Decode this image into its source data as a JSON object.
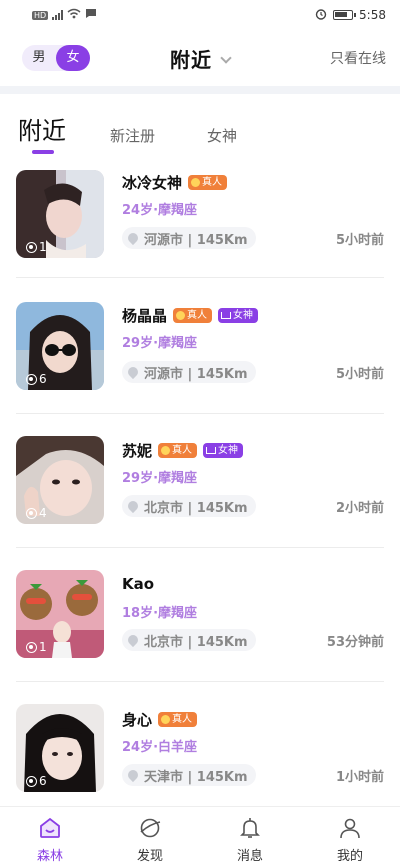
{
  "status_bar": {
    "indicators": "HD ⁴ᴳ",
    "time": "5:58",
    "icons": [
      "hd-icon",
      "signal-icon",
      "wifi-icon",
      "message-icon",
      "alarm-icon",
      "battery-icon"
    ]
  },
  "header": {
    "gender_male": "男",
    "gender_female": "女",
    "title": "附近",
    "online_only": "只看在线"
  },
  "tabs": [
    {
      "label": "附近",
      "active": true
    },
    {
      "label": "新注册",
      "active": false
    },
    {
      "label": "女神",
      "active": false
    }
  ],
  "users": [
    {
      "name": "冰冷女神",
      "badges": [
        "真人"
      ],
      "age_sign": "24岁·摩羯座",
      "location": "河源市 | 145Km",
      "time": "5小时前",
      "photos": "1"
    },
    {
      "name": "杨晶晶",
      "badges": [
        "真人",
        "女神"
      ],
      "age_sign": "29岁·摩羯座",
      "location": "河源市 | 145Km",
      "time": "5小时前",
      "photos": "6"
    },
    {
      "name": "苏妮",
      "badges": [
        "真人",
        "女神"
      ],
      "age_sign": "29岁·摩羯座",
      "location": "北京市 | 145Km",
      "time": "2小时前",
      "photos": "4"
    },
    {
      "name": "Kao",
      "badges": [],
      "age_sign": "18岁·摩羯座",
      "location": "北京市 | 145Km",
      "time": "53分钟前",
      "photos": "1"
    },
    {
      "name": "身心",
      "badges": [
        "真人"
      ],
      "age_sign": "24岁·白羊座",
      "location": "天津市 | 145Km",
      "time": "1小时前",
      "photos": "6"
    }
  ],
  "bottom_nav": [
    {
      "label": "森林",
      "icon": "home-icon",
      "active": true
    },
    {
      "label": "发现",
      "icon": "discover-icon",
      "active": false
    },
    {
      "label": "消息",
      "icon": "bell-icon",
      "active": false
    },
    {
      "label": "我的",
      "icon": "profile-icon",
      "active": false
    }
  ],
  "colors": {
    "accent": "#8a3fe5",
    "real_badge": "#f0803a",
    "meta": "#b07ee0"
  }
}
